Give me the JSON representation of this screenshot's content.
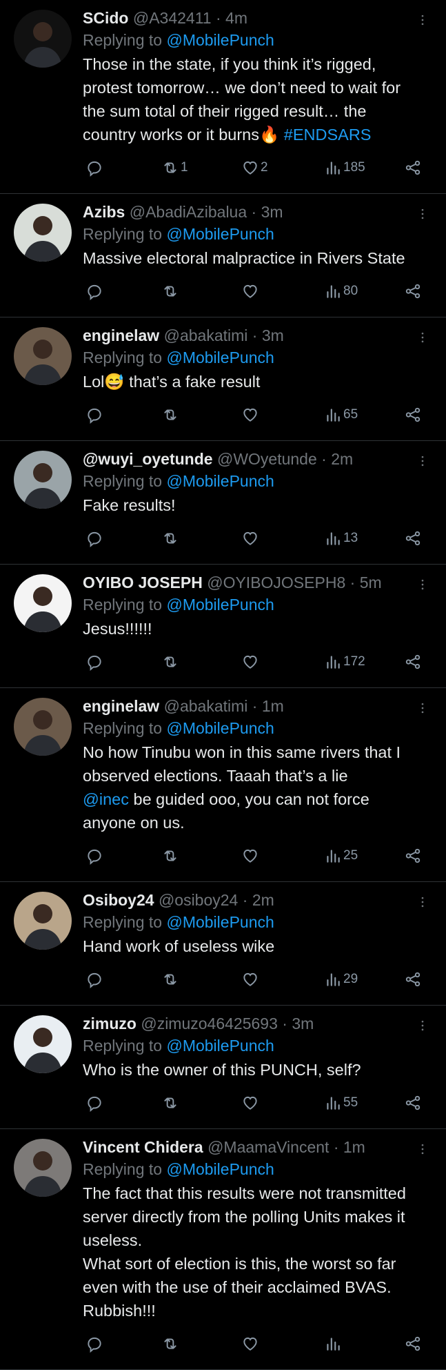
{
  "tweets": [
    {
      "name": "SCido",
      "handle": "@A342411",
      "time": "4m",
      "reply_to": "@MobilePunch",
      "text": "Those in the state, if you think it’s rigged, protest tomorrow… we don’t need to wait for the sum total of their rigged result… the country works or it burns",
      "emoji": "🔥",
      "hashtag": "#ENDSARS",
      "mention": "",
      "text_after": "",
      "retweets": "1",
      "likes": "2",
      "views": "185",
      "avatar_color": "#111111"
    },
    {
      "name": "Azibs",
      "handle": "@AbadiAzibalua",
      "time": "3m",
      "reply_to": "@MobilePunch",
      "text": "Massive electoral malpractice in Rivers State",
      "emoji": "",
      "hashtag": "",
      "mention": "",
      "text_after": "",
      "retweets": "",
      "likes": "",
      "views": "80",
      "avatar_color": "#d8ddd8"
    },
    {
      "name": "enginelaw",
      "handle": "@abakatimi",
      "time": "3m",
      "reply_to": "@MobilePunch",
      "text": "Lol",
      "emoji": "😅",
      "hashtag": "",
      "mention": "",
      "text_after": " that’s a fake result",
      "retweets": "",
      "likes": "",
      "views": "65",
      "avatar_color": "#6b5a4a"
    },
    {
      "name": "@wuyi_oyetunde",
      "handle": "@WOyetunde",
      "time": "2m",
      "reply_to": "@MobilePunch",
      "text": "Fake results!",
      "emoji": "",
      "hashtag": "",
      "mention": "",
      "text_after": "",
      "retweets": "",
      "likes": "",
      "views": "13",
      "avatar_color": "#9aa4a8"
    },
    {
      "name": "OYIBO JOSEPH",
      "handle": "@OYIBOJOSEPH8",
      "time": "5m",
      "reply_to": "@MobilePunch",
      "text": "Jesus!!!!!!",
      "emoji": "",
      "hashtag": "",
      "mention": "",
      "text_after": "",
      "retweets": "",
      "likes": "",
      "views": "172",
      "avatar_color": "#f4f4f4"
    },
    {
      "name": "enginelaw",
      "handle": "@abakatimi",
      "time": "1m",
      "reply_to": "@MobilePunch",
      "text": "No how Tinubu won in this same rivers that I observed elections. Taaah that’s a lie\n",
      "emoji": "",
      "hashtag": "",
      "mention": "@inec",
      "text_after": " be guided ooo, you can not force anyone on us.",
      "retweets": "",
      "likes": "",
      "views": "25",
      "avatar_color": "#6b5a4a"
    },
    {
      "name": "Osiboy24",
      "handle": "@osiboy24",
      "time": "2m",
      "reply_to": "@MobilePunch",
      "text": "Hand work of useless wike",
      "emoji": "",
      "hashtag": "",
      "mention": "",
      "text_after": "",
      "retweets": "",
      "likes": "",
      "views": "29",
      "avatar_color": "#b9a58a"
    },
    {
      "name": "zimuzo",
      "handle": "@zimuzo46425693",
      "time": "3m",
      "reply_to": "@MobilePunch",
      "text": "Who is the owner of this PUNCH, self?",
      "emoji": "",
      "hashtag": "",
      "mention": "",
      "text_after": "",
      "retweets": "",
      "likes": "",
      "views": "55",
      "avatar_color": "#e9eef2"
    },
    {
      "name": "Vincent Chidera",
      "handle": "@MaamaVincent",
      "time": "1m",
      "reply_to": "@MobilePunch",
      "text": "The fact that this results were not transmitted server directly from the polling Units makes it useless.\nWhat sort of election is this, the worst so far even with the use of their acclaimed BVAS. Rubbish!!!",
      "emoji": "",
      "hashtag": "",
      "mention": "",
      "text_after": "",
      "retweets": "",
      "likes": "",
      "views": "",
      "avatar_color": "#7d7a78"
    }
  ],
  "labels": {
    "replying_to": "Replying to",
    "separator": "·"
  },
  "icons": [
    "reply-icon",
    "retweet-icon",
    "like-icon",
    "views-icon",
    "share-icon",
    "more-icon"
  ],
  "colors": {
    "link": "#1d9bf0",
    "muted": "#71767b",
    "background": "#000000",
    "divider": "#2f3336"
  }
}
